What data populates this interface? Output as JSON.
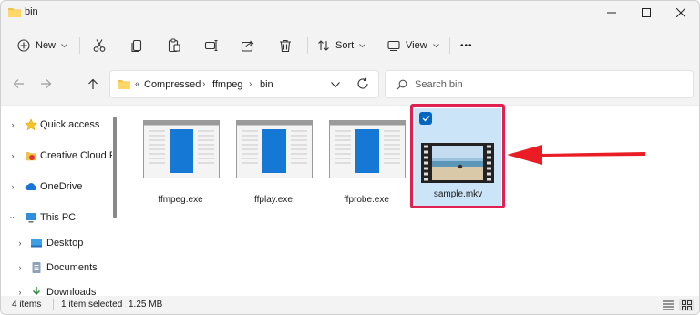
{
  "window": {
    "title": "bin"
  },
  "toolbar": {
    "new_label": "New",
    "sort_label": "Sort",
    "view_label": "View",
    "more_label": "•••"
  },
  "address": {
    "overflow": "«",
    "crumbs": [
      "Compressed",
      "ffmpeg",
      "bin"
    ],
    "separator": "›"
  },
  "search": {
    "placeholder": "Search bin"
  },
  "sidebar": {
    "items": [
      {
        "label": "Quick access",
        "icon": "star-icon"
      },
      {
        "label": "Creative Cloud Fi",
        "icon": "creative-cloud-icon"
      },
      {
        "label": "OneDrive",
        "icon": "cloud-icon"
      },
      {
        "label": "This PC",
        "icon": "monitor-icon"
      },
      {
        "label": "Desktop",
        "icon": "desktop-icon"
      },
      {
        "label": "Documents",
        "icon": "documents-icon"
      },
      {
        "label": "Downloads",
        "icon": "downloads-icon"
      }
    ]
  },
  "files": [
    {
      "name": "ffmpeg.exe",
      "icon": "exe-icon"
    },
    {
      "name": "ffplay.exe",
      "icon": "exe-icon"
    },
    {
      "name": "ffprobe.exe",
      "icon": "exe-icon"
    },
    {
      "name": "sample.mkv",
      "icon": "video-thumbnail",
      "selected": true
    }
  ],
  "status": {
    "items": "4 items",
    "selection": "1 item selected",
    "size": "1.25 MB"
  },
  "colors": {
    "accent": "#0067c0",
    "selection": "#cce4f7",
    "annotation": "#e02050"
  }
}
